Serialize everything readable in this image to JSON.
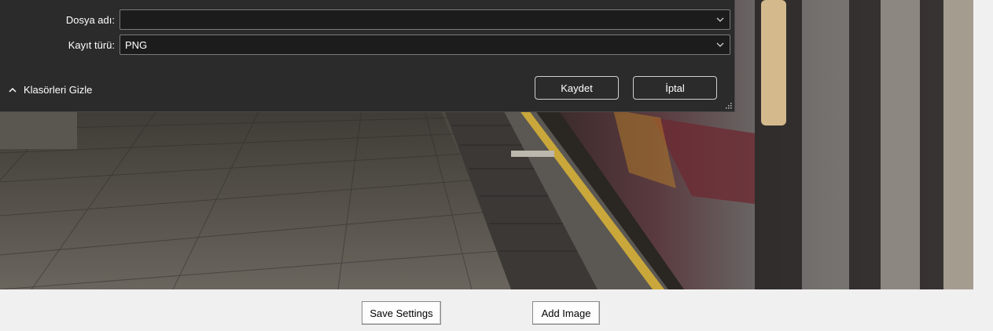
{
  "dialog": {
    "filename_label": "Dosya adı:",
    "filename_value": "",
    "filetype_label": "Kayıt türü:",
    "filetype_value": "PNG",
    "toggle_label": "Klasörleri Gizle",
    "save_label": "Kaydet",
    "cancel_label": "İptal"
  },
  "bottom_bar": {
    "save_settings_label": "Save Settings",
    "add_image_label": "Add Image"
  },
  "icons": {
    "dropdown": "chevron-down-icon",
    "toggle": "chevron-up-icon",
    "resize": "resize-grip-icon"
  }
}
